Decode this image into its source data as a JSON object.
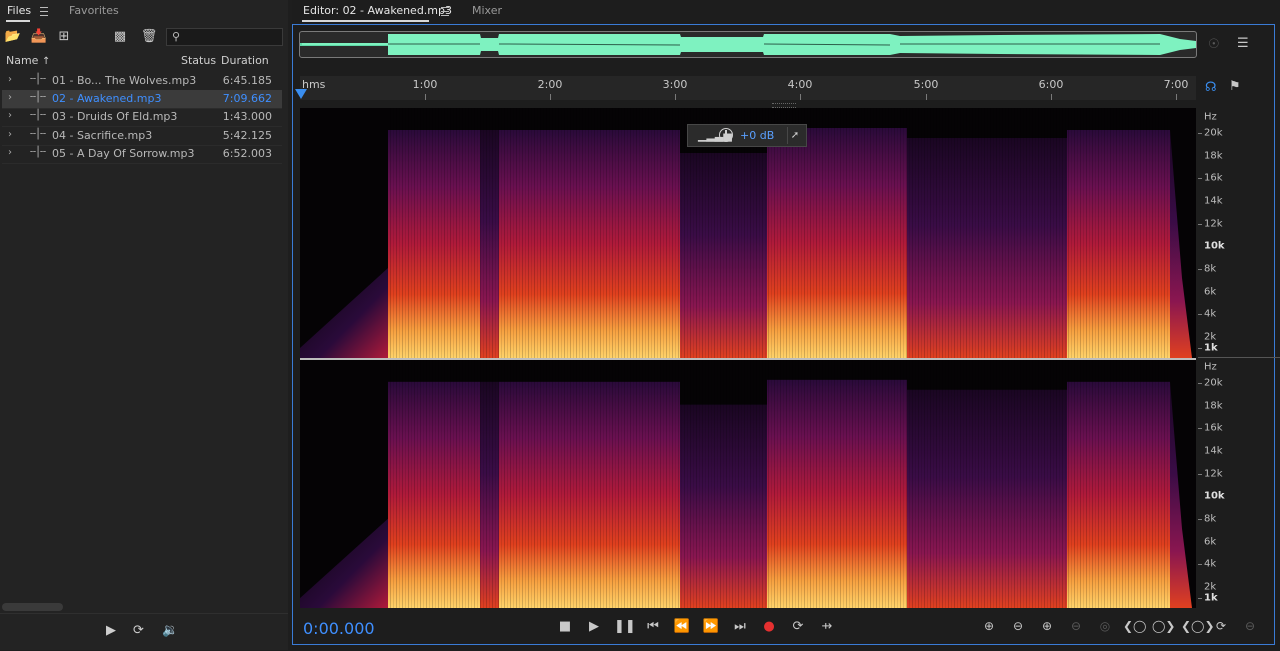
{
  "files_panel": {
    "tab_files": "Files",
    "tab_favorites": "Favorites",
    "search": {
      "placeholder": "",
      "value": ""
    },
    "columns": {
      "name": "Name",
      "sort_arrow": "↑",
      "status": "Status",
      "duration": "Duration"
    },
    "files": [
      {
        "name": "01 - Bo... The Wolves.mp3",
        "duration": "6:45.185"
      },
      {
        "name": "02 - Awakened.mp3",
        "duration": "7:09.662",
        "selected": true
      },
      {
        "name": "03 - Druids Of Eld.mp3",
        "duration": "1:43.000"
      },
      {
        "name": "04 - Sacrifice.mp3",
        "duration": "5:42.125"
      },
      {
        "name": "05 - A Day Of Sorrow.mp3",
        "duration": "6:52.003"
      }
    ]
  },
  "editor": {
    "tab_editor": "Editor: 02 - Awakened.mp3",
    "tab_mixer": "Mixer",
    "ruler_unit": "hms",
    "ruler_ticks": [
      "1:00",
      "2:00",
      "3:00",
      "4:00",
      "5:00",
      "6:00",
      "7:00"
    ],
    "hud_gain": "+0 dB",
    "freq_unit": "Hz",
    "freq_labels": [
      "20k",
      "18k",
      "16k",
      "14k",
      "12k",
      "10k",
      "8k",
      "6k",
      "4k",
      "2k",
      "1k"
    ],
    "current_time": "0:00.000"
  },
  "colors": {
    "accent": "#3f8fff",
    "waveform": "#7ef2c0",
    "spectrum_low": "#2a0a3a",
    "spectrum_mid": "#d9301e",
    "spectrum_high": "#ffd36a"
  }
}
